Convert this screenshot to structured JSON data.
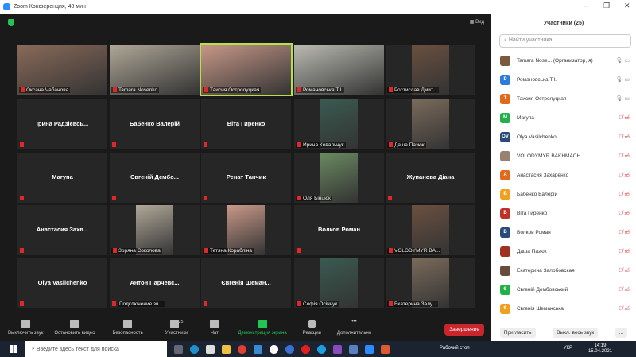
{
  "window": {
    "title": "Zoom Конференция, 40 мин",
    "minimize": "–",
    "restore": "❐",
    "close": "✕"
  },
  "main": {
    "view_label": "Вид"
  },
  "tiles": [
    {
      "name": "Оксана Чабанова",
      "video": true
    },
    {
      "name": "Tamara Nosenko",
      "video": true
    },
    {
      "name": "Таисия Остролуцкая",
      "video": true,
      "active": true
    },
    {
      "name": "Романовська Т.І.",
      "video": true
    },
    {
      "name": "Ростислав Дмит...",
      "video": true
    },
    {
      "name": "Ірина Радзієвсь...",
      "video": false
    },
    {
      "name": "Бабенко Валерій",
      "video": false
    },
    {
      "name": "Віта Гиренко",
      "video": false
    },
    {
      "name": "Ирина Ковальчук",
      "video": true
    },
    {
      "name": "Даша Пазюк",
      "video": true
    },
    {
      "name": "Магупа",
      "video": false
    },
    {
      "name": "Євгеній Дембо...",
      "video": false
    },
    {
      "name": "Ренат Танчик",
      "video": false
    },
    {
      "name": "Оля Бінцюк",
      "video": true
    },
    {
      "name": "Жупанова Діана",
      "video": false
    },
    {
      "name": "Анастасия Захв...",
      "video": false
    },
    {
      "name": "Зоряна Соколова",
      "video": true
    },
    {
      "name": "Тетяна Корабліна",
      "video": true
    },
    {
      "name": "Волков Роман",
      "video": false
    },
    {
      "name": "VOLODYMYR BA...",
      "video": true
    },
    {
      "name": "Olya Vasilchenko",
      "video": false
    },
    {
      "name": "Антон Парчевс...",
      "video": false,
      "sub": "Подключение зв..."
    },
    {
      "name": "Євгенія Шеман...",
      "video": false
    },
    {
      "name": "Софія Осінчук",
      "video": true
    },
    {
      "name": "Екатерина Залу...",
      "video": true
    }
  ],
  "toolbar": {
    "items": [
      "Выключить звук",
      "Остановить видео",
      "Безопасность",
      "Участники",
      "Чат",
      "Демонстрация экрана",
      "Реакции",
      "Дополнительно"
    ],
    "participants_count": "25",
    "end": "Завершение"
  },
  "panel": {
    "title": "Участники (25)",
    "search_placeholder": "Найти участника",
    "participants": [
      {
        "name": "Tamara Nose...  (Организатор, я)",
        "initial": "",
        "color": "#7a5a3a",
        "muted": false
      },
      {
        "name": "Романовська Т.І.",
        "initial": "Р",
        "color": "#2d7bd8",
        "muted": false
      },
      {
        "name": "Таисия Остролуцкая",
        "initial": "Т",
        "color": "#e06a1c",
        "muted": false
      },
      {
        "name": "Магупа",
        "initial": "M",
        "color": "#23b04a",
        "muted": true
      },
      {
        "name": "Olya Vasilchenko",
        "initial": "OV",
        "color": "#2a4a7a",
        "muted": true
      },
      {
        "name": "VOLODYMYR BAKHMACH",
        "initial": "",
        "color": "#9a8070",
        "muted": true
      },
      {
        "name": "Анастасия Захаренко",
        "initial": "А",
        "color": "#e06a1c",
        "muted": true
      },
      {
        "name": "Бабенко Валерій",
        "initial": "Б",
        "color": "#f0a020",
        "muted": true
      },
      {
        "name": "Віта Гиренко",
        "initial": "В",
        "color": "#c0302a",
        "muted": true
      },
      {
        "name": "Волков Роман",
        "initial": "В",
        "color": "#2a4a7a",
        "muted": true
      },
      {
        "name": "Даша Пазюк",
        "initial": "",
        "color": "#a03020",
        "muted": true
      },
      {
        "name": "Екатерина Залобовская",
        "initial": "",
        "color": "#6a4a3a",
        "muted": true
      },
      {
        "name": "Євгеній Дембовський",
        "initial": "Є",
        "color": "#23b04a",
        "muted": true
      },
      {
        "name": "Євгенія Шеманська",
        "initial": "Є",
        "color": "#f0a020",
        "muted": true
      }
    ],
    "invite": "Пригласить",
    "mute_all": "Выкл. весь звук",
    "more": "..."
  },
  "taskbar": {
    "search_placeholder": "Введите здесь текст для поиска",
    "desktop": "Рабочий стол",
    "lang": "УКР",
    "time": "14:19",
    "date": "15.04.2021"
  }
}
